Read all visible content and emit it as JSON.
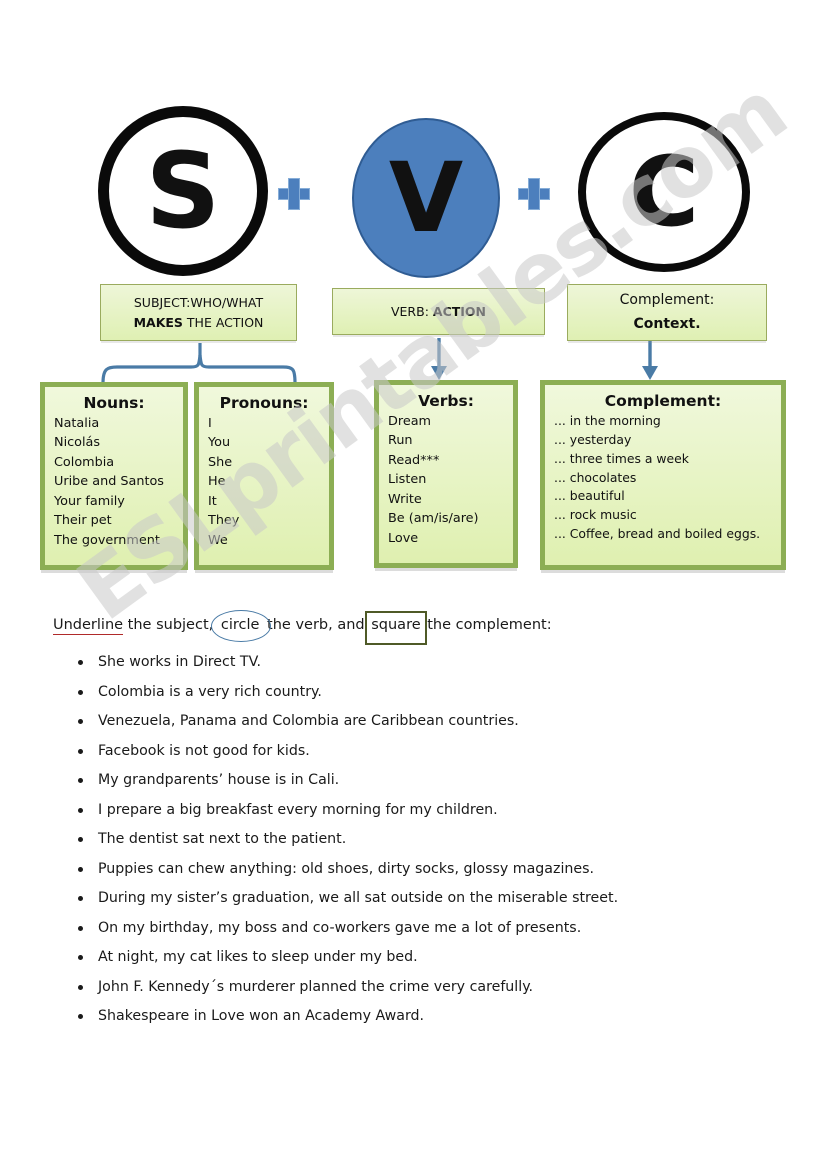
{
  "watermark": {
    "text": "ESLprintables.com"
  },
  "formula": {
    "parts": [
      {
        "letter": "S",
        "name": "subject-circle"
      },
      {
        "letter": "V",
        "name": "verb-circle"
      },
      {
        "letter": "C",
        "name": "complement-circle"
      }
    ],
    "operator": "+"
  },
  "definitions": {
    "subject": {
      "line1": "SUBJECT:WHO/WHAT",
      "line2_bold": "MAKES",
      "line2_rest": " THE ACTION"
    },
    "verb": {
      "line1_plain": "VERB: ",
      "line1_bold": "ACTION"
    },
    "complement": {
      "line1": "Complement:",
      "line2": "Context."
    }
  },
  "categories": [
    {
      "title": "Nouns:",
      "items": [
        "Natalia",
        "Nicolás",
        "Colombia",
        "Uribe and Santos",
        "Your family",
        "Their pet",
        "The government"
      ]
    },
    {
      "title": "Pronouns:",
      "items": [
        "I",
        "You",
        "She",
        "He",
        "It",
        "They",
        "We"
      ]
    },
    {
      "title": "Verbs:",
      "items": [
        "Dream",
        "Run",
        "Read***",
        "Listen",
        "Write",
        "Be (am/is/are)",
        "Love"
      ]
    },
    {
      "title": "Complement:",
      "items": [
        "... in the morning",
        "... yesterday",
        "... three times a week",
        "... chocolates",
        "... beautiful",
        "... rock music",
        "... Coffee, bread and boiled eggs."
      ]
    }
  ],
  "instruction": {
    "word_underline": "Underline",
    "seg1": " the subject, ",
    "word_circle": "circle",
    "seg2": " the verb, and ",
    "word_square": "square",
    "seg3": " the complement:"
  },
  "exercise": {
    "sentences": [
      "She works in Direct TV.",
      "Colombia is a very rich country.",
      "Venezuela, Panama and Colombia are Caribbean countries.",
      "Facebook is not good for kids.",
      "My grandparents’ house is in Cali.",
      "I prepare a big breakfast every morning for my children.",
      "The dentist sat next to the patient.",
      "Puppies can chew anything: old shoes, dirty socks, glossy magazines.",
      "During my sister’s graduation, we all sat outside on the miserable street.",
      "On my birthday, my boss and co-workers gave me a lot of presents.",
      "At night, my cat likes to sleep under my bed.",
      "John F. Kennedy´s murderer planned the crime very carefully.",
      "Shakespeare in Love won an Academy Award."
    ]
  },
  "colors": {
    "verb_circle_fill": "#4c7fbd",
    "plus": "#4c7fbd",
    "box_border": "#8cae54",
    "box_fill": "#dff0b0",
    "connector": "#4a7ba6",
    "underline_red": "#b02a2a",
    "square_olive": "#4f5a27",
    "circle_blue": "#4a7ba6",
    "watermark": "#c9c9c9"
  }
}
